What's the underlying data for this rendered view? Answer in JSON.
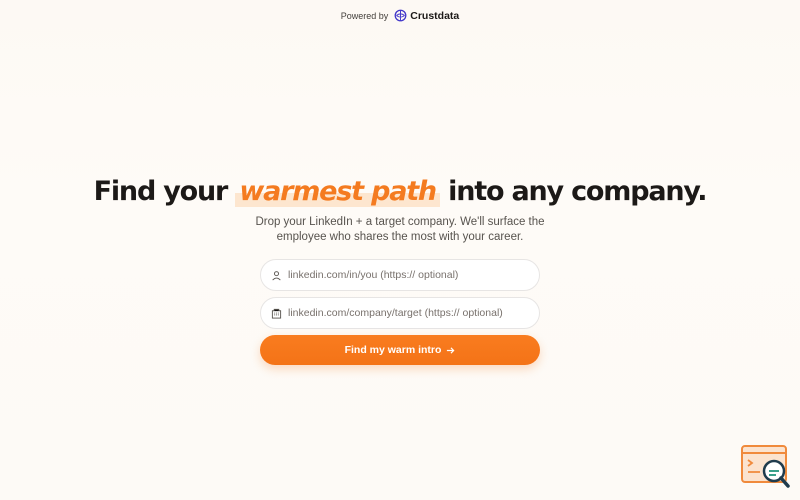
{
  "header": {
    "powered_by": "Powered by",
    "brand": "Crustdata"
  },
  "hero": {
    "headline_pre": "Find your",
    "headline_highlight": "warmest path",
    "headline_post": "into any company.",
    "subtitle": "Drop your LinkedIn + a target company. We'll surface the employee who shares the most with your career."
  },
  "form": {
    "linkedin_placeholder": "linkedin.com/in/you (https:// optional)",
    "company_placeholder": "linkedin.com/company/target (https:// optional)",
    "submit_label": "Find my warm intro"
  },
  "icons": {
    "brand": "crustdata-logo-icon",
    "linkedin_field": "person-icon",
    "company_field": "building-icon",
    "submit": "arrow-right-icon",
    "widget": "search-console-icon"
  },
  "colors": {
    "accent": "#f47b20",
    "background": "#fdf9f4"
  }
}
